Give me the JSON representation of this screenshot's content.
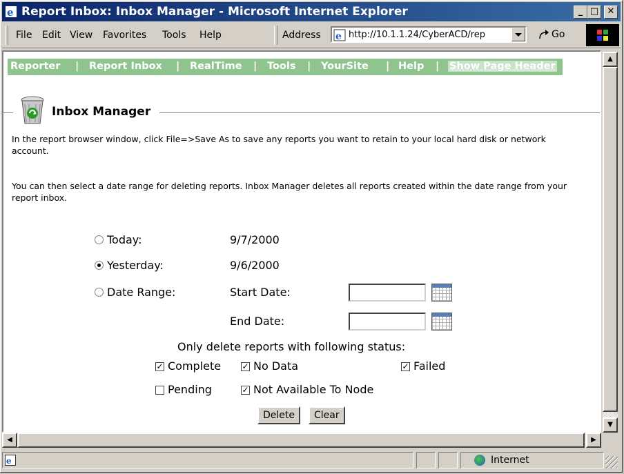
{
  "window": {
    "title": "Report Inbox: Inbox Manager - Microsoft Internet Explorer",
    "controls": {
      "minimize": "_",
      "maximize": "□",
      "close": "✕"
    }
  },
  "menubar": {
    "items": [
      "File",
      "Edit",
      "View",
      "Favorites",
      "Tools",
      "Help"
    ],
    "address_label": "Address",
    "address_url": "http://10.1.1.24/CyberACD/rep",
    "go_label": "Go"
  },
  "nav": {
    "links": [
      "Reporter",
      "Report Inbox",
      "RealTime",
      "Tools",
      "YourSite",
      "Help"
    ],
    "separator": "|",
    "show_header": "Show Page Header"
  },
  "page": {
    "title": "Inbox Manager",
    "para1": "In the report browser window, click File=>Save As to save any reports you want to retain to your local hard disk or network account.",
    "para2": "You can then select a date range for deleting reports. Inbox Manager deletes all reports created within the date range from your report inbox."
  },
  "form": {
    "options": [
      {
        "label": "Today:",
        "value": "9/7/2000",
        "selected": false
      },
      {
        "label": "Yesterday:",
        "value": "9/6/2000",
        "selected": true
      },
      {
        "label": "Date Range:",
        "value": "",
        "selected": false
      }
    ],
    "start_date_label": "Start Date:",
    "end_date_label": "End Date:",
    "start_date_value": "",
    "end_date_value": "",
    "status_heading": "Only delete reports with following status:",
    "statuses": [
      {
        "label": "Complete",
        "checked": true
      },
      {
        "label": "No Data",
        "checked": true
      },
      {
        "label": "Failed",
        "checked": true
      },
      {
        "label": "Pending",
        "checked": false
      },
      {
        "label": "Not Available To Node",
        "checked": true
      }
    ],
    "delete_label": "Delete",
    "clear_label": "Clear"
  },
  "statusbar": {
    "zone": "Internet"
  },
  "colors": {
    "titlebar_start": "#0a246a",
    "titlebar_end": "#3a6ea5",
    "nav_bg": "#8fc48f",
    "chrome": "#d4d0c8"
  }
}
